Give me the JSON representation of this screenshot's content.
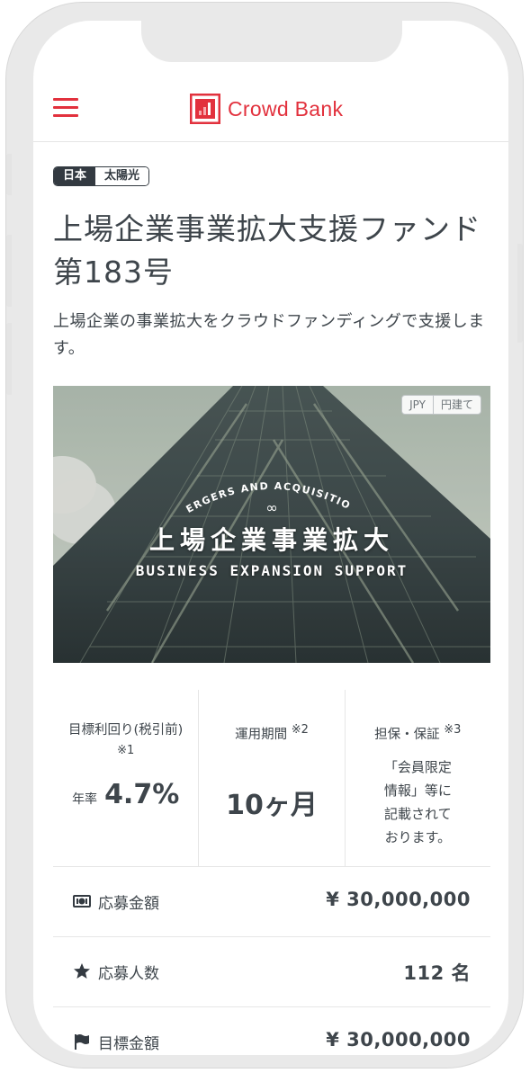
{
  "header": {
    "brand": "Crowd Bank",
    "brand_color": "#e2313d",
    "menu_icon": "hamburger-menu-icon"
  },
  "fund": {
    "tags": [
      "日本",
      "太陽光"
    ],
    "title": "上場企業事業拡大支援ファンド第183号",
    "subtitle": "上場企業の事業拡大をクラウドファンディングで支援します。",
    "image": {
      "badge_currency": "JPY",
      "badge_label": "円建て",
      "arc_text": "MERGERS AND ACQUISITIONS",
      "infinity": "∞",
      "main_text": "上場企業事業拡大",
      "sub_text": "BUSINESS EXPANSION SUPPORT"
    }
  },
  "stats": [
    {
      "label": "目標利回り(税引前)",
      "note": "※1",
      "prefix": "年率",
      "value": "4.7%"
    },
    {
      "label": "運用期間",
      "note": "※2",
      "value": "10ヶ月"
    },
    {
      "label": "担保・保証",
      "note": "※3",
      "text_lines": [
        "「会員限定",
        "情報」等に",
        "記載されて",
        "おります。"
      ]
    }
  ],
  "rows": [
    {
      "icon": "money-icon",
      "label": "応募金額",
      "value": "¥ 30,000,000"
    },
    {
      "icon": "star-icon",
      "label": "応募人数",
      "value": "112 名"
    },
    {
      "icon": "flag-icon",
      "label": "目標金額",
      "value": "¥ 30,000,000"
    }
  ]
}
